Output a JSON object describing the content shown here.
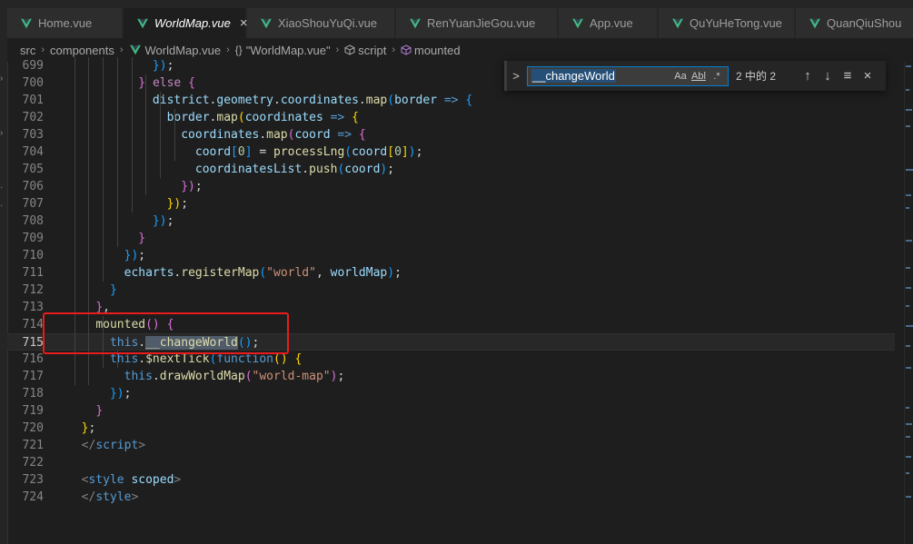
{
  "tabs": [
    {
      "label": "Home.vue",
      "active": false
    },
    {
      "label": "WorldMap.vue",
      "active": true
    },
    {
      "label": "XiaoShouYuQi.vue",
      "active": false
    },
    {
      "label": "RenYuanJieGou.vue",
      "active": false
    },
    {
      "label": "App.vue",
      "active": false
    },
    {
      "label": "QuYuHeTong.vue",
      "active": false
    },
    {
      "label": "QuanQiuShou",
      "active": false
    }
  ],
  "tab_close_glyph": "×",
  "breadcrumb": {
    "parts": [
      "src",
      "components",
      "WorldMap.vue",
      "\"WorldMap.vue\"",
      "script",
      "mounted"
    ],
    "object_glyph": "{}"
  },
  "find_widget": {
    "query": "__changeWorld",
    "match_case": "Aa",
    "whole_word": "Abl",
    "regex": ".*",
    "result": "2 中的 2",
    "prev": "↑",
    "next": "↓",
    "selection": "≡",
    "close": "×",
    "toggle": ">"
  },
  "code_lines": [
    {
      "n": "699",
      "segs": [
        [
          "            ",
          ""
        ],
        [
          "})",
          "t-br3"
        ],
        [
          ";",
          "t-punc"
        ]
      ]
    },
    {
      "n": "700",
      "segs": [
        [
          "          ",
          ""
        ],
        [
          "}",
          "t-br2"
        ],
        [
          " ",
          ""
        ],
        [
          "else",
          "t-kw"
        ],
        [
          " ",
          ""
        ],
        [
          "{",
          "t-br2"
        ]
      ]
    },
    {
      "n": "701",
      "segs": [
        [
          "            ",
          ""
        ],
        [
          "district",
          "t-var"
        ],
        [
          ".",
          "t-punc"
        ],
        [
          "geometry",
          "t-var"
        ],
        [
          ".",
          "t-punc"
        ],
        [
          "coordinates",
          "t-var"
        ],
        [
          ".",
          "t-punc"
        ],
        [
          "map",
          "t-fn"
        ],
        [
          "(",
          "t-br3"
        ],
        [
          "border",
          "t-var"
        ],
        [
          " => ",
          "t-this"
        ],
        [
          "{",
          "t-br3"
        ]
      ]
    },
    {
      "n": "702",
      "segs": [
        [
          "              ",
          ""
        ],
        [
          "border",
          "t-var"
        ],
        [
          ".",
          "t-punc"
        ],
        [
          "map",
          "t-fn"
        ],
        [
          "(",
          "t-br1"
        ],
        [
          "coordinates",
          "t-var"
        ],
        [
          " => ",
          "t-this"
        ],
        [
          "{",
          "t-br1"
        ]
      ]
    },
    {
      "n": "703",
      "segs": [
        [
          "                ",
          ""
        ],
        [
          "coordinates",
          "t-var"
        ],
        [
          ".",
          "t-punc"
        ],
        [
          "map",
          "t-fn"
        ],
        [
          "(",
          "t-br2"
        ],
        [
          "coord",
          "t-var"
        ],
        [
          " => ",
          "t-this"
        ],
        [
          "{",
          "t-br2"
        ]
      ]
    },
    {
      "n": "704",
      "segs": [
        [
          "                  ",
          ""
        ],
        [
          "coord",
          "t-var"
        ],
        [
          "[",
          "t-br3"
        ],
        [
          "0",
          "t-num"
        ],
        [
          "]",
          "t-br3"
        ],
        [
          " = ",
          "t-punc"
        ],
        [
          "processLng",
          "t-fn"
        ],
        [
          "(",
          "t-br3"
        ],
        [
          "coord",
          "t-var"
        ],
        [
          "[",
          "t-br1"
        ],
        [
          "0",
          "t-num"
        ],
        [
          "]",
          "t-br1"
        ],
        [
          ")",
          "t-br3"
        ],
        [
          ";",
          "t-punc"
        ]
      ]
    },
    {
      "n": "705",
      "segs": [
        [
          "                  ",
          ""
        ],
        [
          "coordinatesList",
          "t-var"
        ],
        [
          ".",
          "t-punc"
        ],
        [
          "push",
          "t-fn"
        ],
        [
          "(",
          "t-br3"
        ],
        [
          "coord",
          "t-var"
        ],
        [
          ")",
          "t-br3"
        ],
        [
          ";",
          "t-punc"
        ]
      ]
    },
    {
      "n": "706",
      "segs": [
        [
          "                ",
          ""
        ],
        [
          "})",
          "t-br2"
        ],
        [
          ";",
          "t-punc"
        ]
      ]
    },
    {
      "n": "707",
      "segs": [
        [
          "              ",
          ""
        ],
        [
          "})",
          "t-br1"
        ],
        [
          ";",
          "t-punc"
        ]
      ]
    },
    {
      "n": "708",
      "segs": [
        [
          "            ",
          ""
        ],
        [
          "})",
          "t-br3"
        ],
        [
          ";",
          "t-punc"
        ]
      ]
    },
    {
      "n": "709",
      "segs": [
        [
          "          ",
          ""
        ],
        [
          "}",
          "t-br2"
        ]
      ]
    },
    {
      "n": "710",
      "segs": [
        [
          "        ",
          ""
        ],
        [
          "})",
          "t-br3"
        ],
        [
          ";",
          "t-punc"
        ]
      ]
    },
    {
      "n": "711",
      "segs": [
        [
          "        ",
          ""
        ],
        [
          "echarts",
          "t-var"
        ],
        [
          ".",
          "t-punc"
        ],
        [
          "registerMap",
          "t-fn"
        ],
        [
          "(",
          "t-br3"
        ],
        [
          "\"world\"",
          "t-str"
        ],
        [
          ", ",
          "t-punc"
        ],
        [
          "worldMap",
          "t-var"
        ],
        [
          ")",
          "t-br3"
        ],
        [
          ";",
          "t-punc"
        ]
      ]
    },
    {
      "n": "712",
      "segs": [
        [
          "      ",
          ""
        ],
        [
          "}",
          "t-br3"
        ]
      ]
    },
    {
      "n": "713",
      "segs": [
        [
          "    ",
          ""
        ],
        [
          "}",
          "t-br2"
        ],
        [
          ",",
          "t-punc"
        ]
      ]
    },
    {
      "n": "714",
      "segs": [
        [
          "    ",
          ""
        ],
        [
          "mounted",
          "t-fn"
        ],
        [
          "()",
          "t-br2"
        ],
        [
          " ",
          ""
        ],
        [
          "{",
          "t-br2"
        ]
      ]
    },
    {
      "n": "715",
      "current": true,
      "segs": [
        [
          "      ",
          ""
        ],
        [
          "this",
          "t-this"
        ],
        [
          ".",
          "t-punc"
        ],
        [
          "__changeWorld",
          "t-fn hl"
        ],
        [
          "()",
          "t-br3"
        ],
        [
          ";",
          "t-punc"
        ]
      ]
    },
    {
      "n": "716",
      "segs": [
        [
          "      ",
          ""
        ],
        [
          "this",
          "t-this"
        ],
        [
          ".",
          "t-punc"
        ],
        [
          "$nextTick",
          "t-fn"
        ],
        [
          "(",
          "t-br3"
        ],
        [
          "function",
          "t-this"
        ],
        [
          "()",
          "t-br1"
        ],
        [
          " ",
          ""
        ],
        [
          "{",
          "t-br1"
        ]
      ]
    },
    {
      "n": "717",
      "segs": [
        [
          "        ",
          ""
        ],
        [
          "this",
          "t-this"
        ],
        [
          ".",
          "t-punc"
        ],
        [
          "drawWorldMap",
          "t-fn"
        ],
        [
          "(",
          "t-br2"
        ],
        [
          "\"world-map\"",
          "t-str"
        ],
        [
          ")",
          "t-br2"
        ],
        [
          ";",
          "t-punc"
        ]
      ]
    },
    {
      "n": "718",
      "segs": [
        [
          "      ",
          ""
        ],
        [
          "})",
          "t-br3"
        ],
        [
          ";",
          "t-punc"
        ]
      ]
    },
    {
      "n": "719",
      "segs": [
        [
          "    ",
          ""
        ],
        [
          "}",
          "t-br2"
        ]
      ]
    },
    {
      "n": "720",
      "segs": [
        [
          "  ",
          ""
        ],
        [
          "}",
          "t-br1"
        ],
        [
          ";",
          "t-punc"
        ]
      ]
    },
    {
      "n": "721",
      "segs": [
        [
          "  ",
          ""
        ],
        [
          "</",
          "t-gray"
        ],
        [
          "script",
          "t-tag"
        ],
        [
          ">",
          "t-gray"
        ]
      ]
    },
    {
      "n": "722",
      "segs": []
    },
    {
      "n": "723",
      "segs": [
        [
          "  ",
          ""
        ],
        [
          "<",
          "t-gray"
        ],
        [
          "style",
          "t-tag"
        ],
        [
          " ",
          ""
        ],
        [
          "scoped",
          "t-attr"
        ],
        [
          ">",
          "t-gray"
        ]
      ]
    },
    {
      "n": "724",
      "segs": [
        [
          "  ",
          ""
        ],
        [
          "</",
          "t-gray"
        ],
        [
          "style",
          "t-tag"
        ],
        [
          ">",
          "t-gray"
        ]
      ]
    }
  ],
  "colors": {
    "editor_bg": "#1e1e1e",
    "annotation_box": "#e81c1c",
    "find_border": "#007fd4",
    "vue_green": "#41b883"
  }
}
